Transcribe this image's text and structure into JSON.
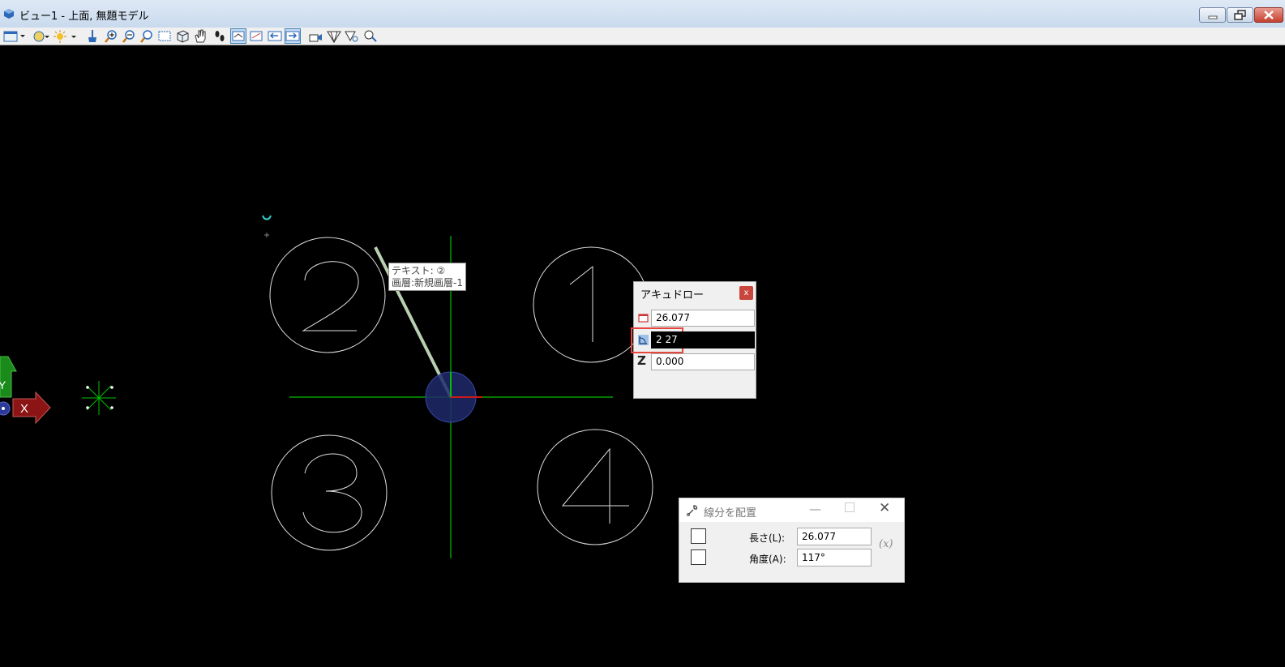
{
  "window": {
    "title": "ビュー1 - 上面, 無題モデル",
    "controls": [
      "minimize-icon",
      "restore-icon",
      "close-icon"
    ]
  },
  "toolbar": {
    "buttons": [
      "view-attributes-icon",
      "display-style-icon",
      "lighting-icon",
      "update-view-icon",
      "zoom-in-icon",
      "zoom-out-icon",
      "window-area-icon",
      "fit-view-icon",
      "rotate-view-icon",
      "pan-view-icon",
      "walk-icon",
      "view-previous-icon",
      "view-next-icon",
      "clip-volume-icon",
      "clip-mask-icon",
      "camera-icon",
      "fence-icon",
      "fence-clip-icon",
      "fence-mask-icon",
      "view-toggle-icon"
    ]
  },
  "canvas": {
    "tooltip": {
      "line1": "テキスト: ②",
      "line2": "画層:新規画層-1"
    },
    "circles": [
      {
        "label": "2"
      },
      {
        "label": "1"
      },
      {
        "label": "3"
      },
      {
        "label": "4"
      }
    ],
    "axes": {
      "x_label": "X",
      "y_label": "Y"
    },
    "colors": {
      "axis_line": "#00c000",
      "circle": "#e0e0e0",
      "compass": "#2b3a8f",
      "x_arrow": "#8b1414",
      "y_arrow": "#1a8a1a"
    }
  },
  "accudraw": {
    "title": "アキュドロー",
    "close_label": "x",
    "distance_value": "26.077",
    "angle_value": "2 27",
    "z_label": "Z",
    "z_value": "0.000"
  },
  "place_line": {
    "title": "線分を配置",
    "length_label": "長さ(L):",
    "length_value": "26.077",
    "angle_label": "角度(A):",
    "angle_value": "117°",
    "fx_label": "(x)"
  }
}
